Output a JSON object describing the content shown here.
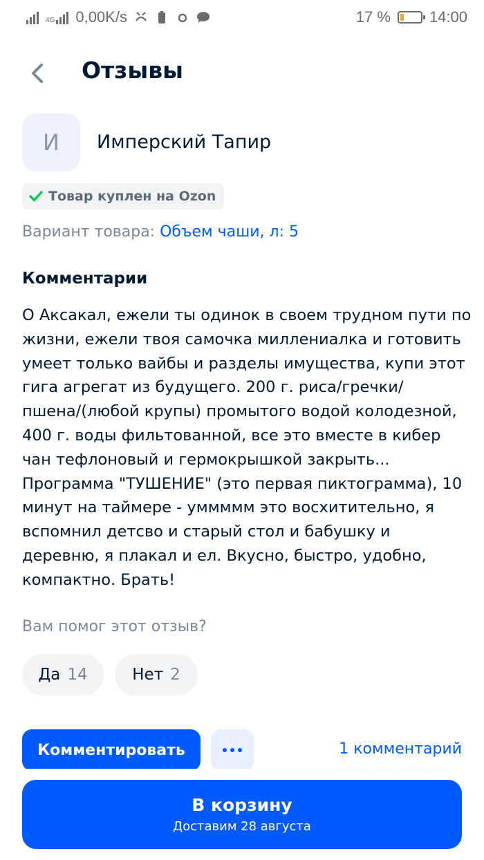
{
  "status_bar": {
    "network_tag": "4G",
    "speed": "0,00K/s",
    "battery": "17 %",
    "battery_level": 0.17,
    "time": "14:00"
  },
  "header": {
    "title": "Отзывы"
  },
  "review": {
    "avatar_letter": "И",
    "author": "Имперский Тапир",
    "verified_badge": "Товар куплен на Ozon",
    "variant_label": "Вариант товара:",
    "variant_value": "Объем чаши, л: 5",
    "comments_heading": "Комментарии",
    "comment_text": "О Аксакал, ежели ты одинок в своем трудном пути по жизни, ежели твоя самочка миллениалка и готовить умеет только вайбы и разделы имущества, купи этот гига агрегат из будущего. 200 г. риса/гречки/пшена/(любой крупы) промытого водой колодезной, 400 г. воды фильтованной, все это вместе в кибер чан тефлоновый и гермокрышкой закрыть... Программа \"ТУШЕНИЕ\" (это первая пиктограмма), 10 минут на таймере - уммммм это восхитительно, я вспомнил детсво и старый стол и бабушку и деревню, я плакал и ел. Вкусно, быстро, удобно, компактно. Брать!",
    "helpful_question": "Вам помог этот отзыв?",
    "yes_label": "Да",
    "yes_count": "14",
    "no_label": "Нет",
    "no_count": "2"
  },
  "actions": {
    "comment_button": "Комментировать",
    "comments_link": "1 комментарий"
  },
  "cart": {
    "title": "В корзину",
    "subtitle": "Доставим 28 августа"
  },
  "colors": {
    "accent": "#005bff",
    "text": "#001a34",
    "muted": "#7a8794",
    "verified": "#10c44c"
  },
  "icons": [
    "signal-icon",
    "mute-icon",
    "battery-saver-icon",
    "circle-icon",
    "chat-icon",
    "back-arrow-icon",
    "check-icon",
    "more-dots-icon"
  ]
}
